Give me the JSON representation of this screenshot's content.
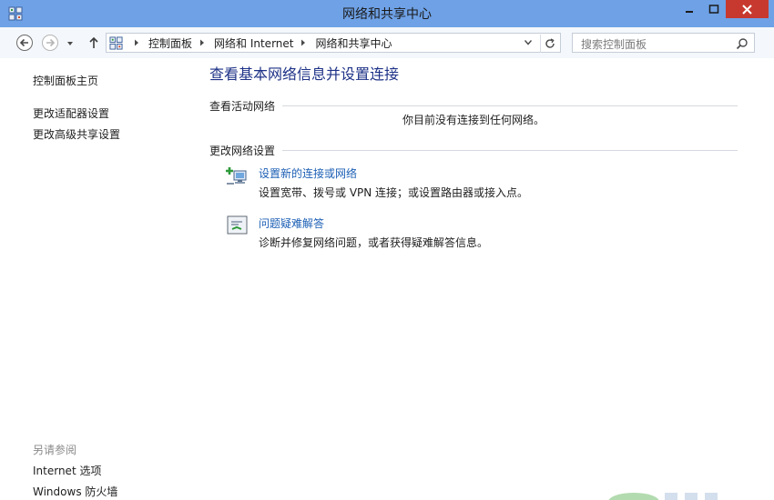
{
  "window": {
    "title": "网络和共享中心"
  },
  "navigation": {
    "breadcrumbs": [
      "控制面板",
      "网络和 Internet",
      "网络和共享中心"
    ],
    "search_placeholder": "搜索控制面板"
  },
  "sidebar": {
    "items": [
      {
        "label": "控制面板主页"
      },
      {
        "label": "更改适配器设置"
      },
      {
        "label": "更改高级共享设置"
      }
    ],
    "see_also_heading": "另请参阅",
    "see_also": [
      {
        "label": "Internet 选项"
      },
      {
        "label": "Windows 防火墙"
      }
    ]
  },
  "main": {
    "title": "查看基本网络信息并设置连接",
    "active_networks_heading": "查看活动网络",
    "no_network_text": "你目前没有连接到任何网络。",
    "change_settings_heading": "更改网络设置",
    "tasks": [
      {
        "icon": "network-setup-icon",
        "link": "设置新的连接或网络",
        "description": "设置宽带、拨号或 VPN 连接；或设置路由器或接入点。"
      },
      {
        "icon": "troubleshoot-icon",
        "link": "问题疑难解答",
        "description": "诊断并修复网络问题，或者获得疑难解答信息。"
      }
    ]
  },
  "colors": {
    "titlebar": "#6ea1e6",
    "close_button": "#c7392f",
    "link": "#1c5fb5",
    "heading": "#1e3287"
  }
}
